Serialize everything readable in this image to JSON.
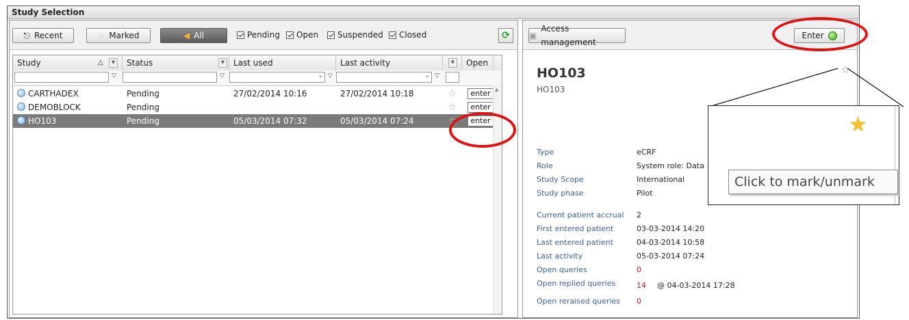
{
  "window": {
    "title": "Study Selection"
  },
  "toolbar": {
    "recent_label": "Recent",
    "marked_label": "Marked",
    "all_label": "All",
    "filters": [
      {
        "label": "Pending",
        "checked": true
      },
      {
        "label": "Open",
        "checked": true
      },
      {
        "label": "Suspended",
        "checked": true
      },
      {
        "label": "Closed",
        "checked": true
      }
    ],
    "refresh_icon": "refresh-icon"
  },
  "grid": {
    "columns": {
      "study": "Study",
      "status": "Status",
      "last_used": "Last used",
      "last_activity": "Last activity",
      "open": "Open"
    },
    "rows": [
      {
        "study": "CARTHADEX",
        "status": "Pending",
        "last_used": "27/02/2014 10:16",
        "last_activity": "27/02/2014 10:18",
        "action": "enter",
        "selected": false
      },
      {
        "study": "DEMOBLOCK",
        "status": "Pending",
        "last_used": "",
        "last_activity": "",
        "action": "enter",
        "selected": false
      },
      {
        "study": "HO103",
        "status": "Pending",
        "last_used": "05/03/2014 07:32",
        "last_activity": "05/03/2014 07:24",
        "action": "enter",
        "selected": true
      }
    ]
  },
  "detail": {
    "access_management_label": "Access management",
    "enter_label": "Enter",
    "study_code": "HO103",
    "study_name": "HO103",
    "fields_a": [
      {
        "label": "Type",
        "value": "eCRF"
      },
      {
        "label": "Role",
        "value": "System role: Data"
      },
      {
        "label": "Study Scope",
        "value": "International"
      },
      {
        "label": "Study phase",
        "value": "Pilot"
      }
    ],
    "fields_b": [
      {
        "label": "Current patient accrual",
        "value": "2"
      },
      {
        "label": "First entered patient",
        "value": "03-03-2014 14:20"
      },
      {
        "label": "Last entered patient",
        "value": "04-03-2014 10:58"
      },
      {
        "label": "Last activity",
        "value": "05-03-2014 07:24"
      },
      {
        "label": "Open queries",
        "value": "0"
      },
      {
        "label": "Open replied queries",
        "value": "14",
        "extra": "@ 04-03-2014 17:28"
      },
      {
        "label": "Open reraised queries",
        "value": "0"
      }
    ]
  },
  "callout": {
    "tooltip": "Click to mark/unmark"
  },
  "colors": {
    "highlight": "#e01010",
    "selected_row": "#7a7a7a",
    "link_label": "#3a5fa0",
    "alert_value": "#d01818"
  }
}
